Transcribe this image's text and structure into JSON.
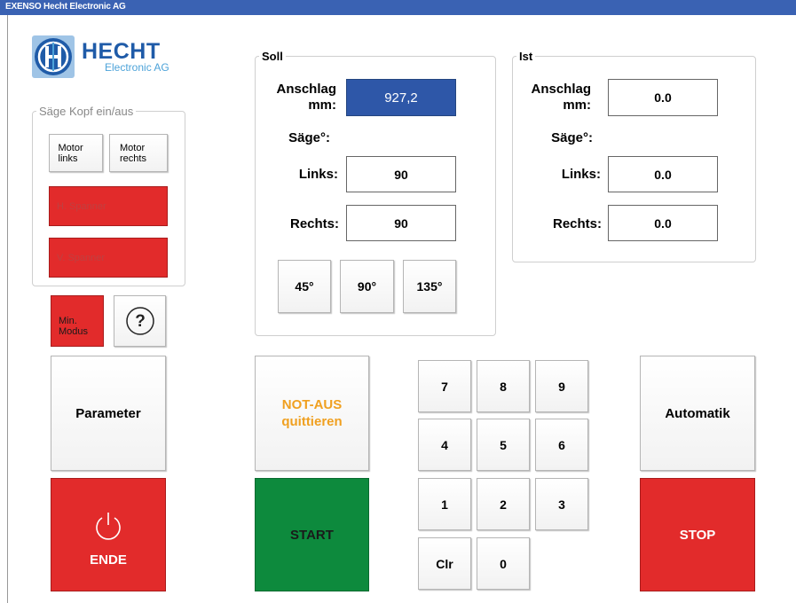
{
  "window": {
    "title": "EXENSO Hecht Electronic AG"
  },
  "logo": {
    "name": "HECHT",
    "subtitle": "Electronic AG",
    "colors": {
      "blue": "#1f5ba8",
      "light_blue": "#4da3d9"
    }
  },
  "kopf": {
    "title": "Säge Kopf ein/aus",
    "motor_links": "Motor links",
    "motor_rechts": "Motor rechts",
    "h_spanner": "H. Spanner",
    "v_spanner": "V. Spanner"
  },
  "min_modus": "Min. Modus",
  "help": {
    "symbol": "?"
  },
  "soll": {
    "title": "Soll",
    "anschlag_label": "Anschlag mm:",
    "anschlag_value": "927,2",
    "saege_label": "Säge°:",
    "links_label": "Links:",
    "links_value": "90",
    "rechts_label": "Rechts:",
    "rechts_value": "90",
    "angle_buttons": [
      "45°",
      "90°",
      "135°"
    ]
  },
  "ist": {
    "title": "Ist",
    "anschlag_label": "Anschlag mm:",
    "anschlag_value": "0.0",
    "saege_label": "Säge°:",
    "links_label": "Links:",
    "links_value": "0.0",
    "rechts_label": "Rechts:",
    "rechts_value": "0.0"
  },
  "buttons": {
    "parameter": "Parameter",
    "not_aus_line1": "NOT-AUS",
    "not_aus_line2": "quittieren",
    "automatik": "Automatik",
    "ende": "ENDE",
    "start": "START",
    "stop": "STOP"
  },
  "keypad": {
    "keys": [
      "7",
      "8",
      "9",
      "4",
      "5",
      "6",
      "1",
      "2",
      "3",
      "Clr",
      "0"
    ]
  },
  "colors": {
    "title_bar": "#3a62b3",
    "red": "#e22b2b",
    "green": "#0d8a3d",
    "orange": "#f0a020",
    "blue_field": "#2e57a8"
  }
}
